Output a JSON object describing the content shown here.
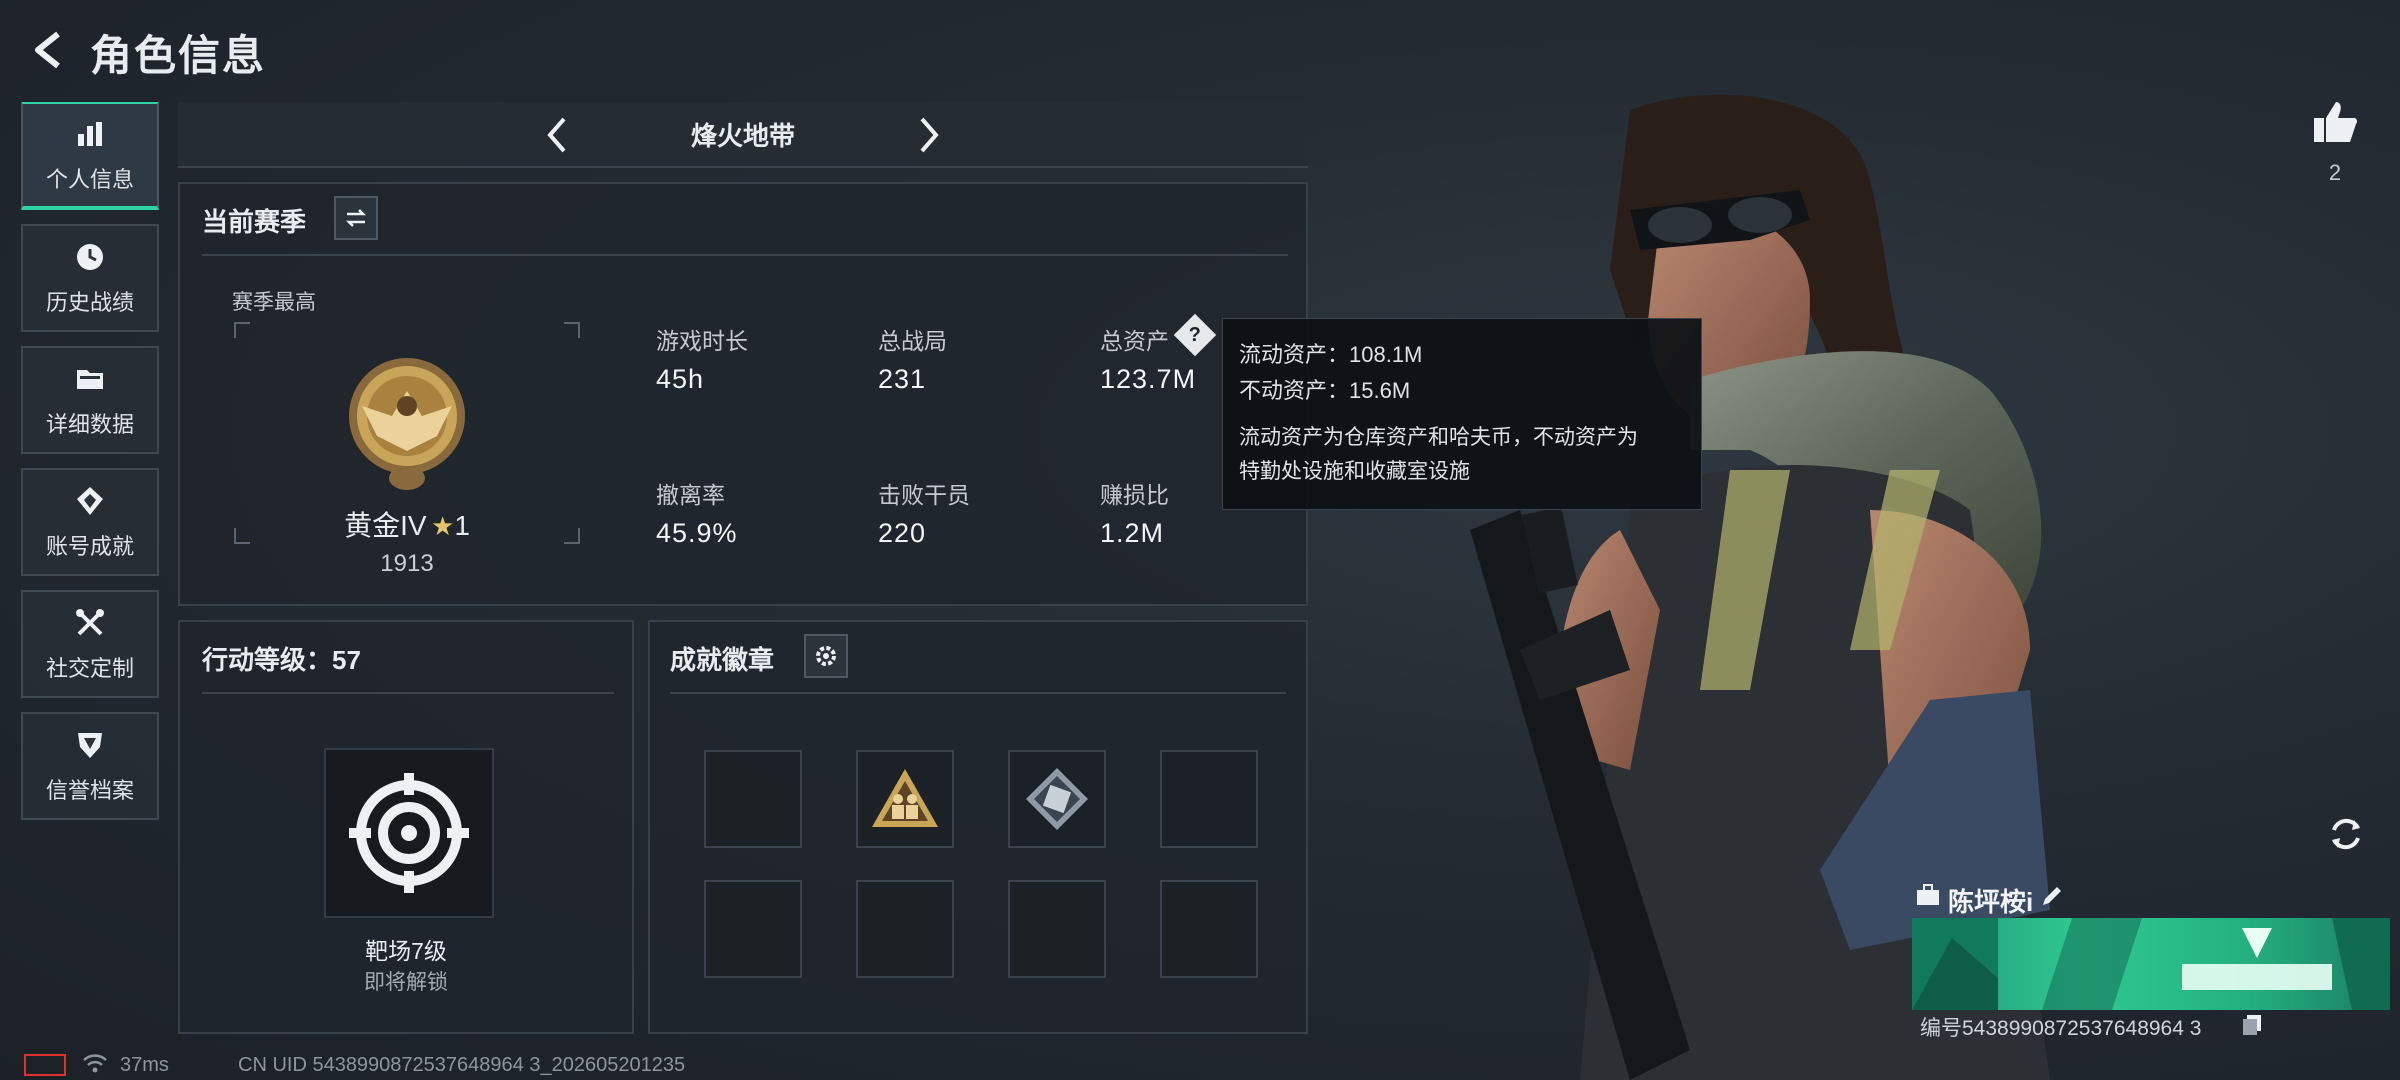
{
  "header": {
    "title": "角色信息"
  },
  "sidebar": {
    "items": [
      {
        "label": "个人信息",
        "icon": "bar-chart-icon",
        "active": true
      },
      {
        "label": "历史战绩",
        "icon": "clock-icon"
      },
      {
        "label": "详细数据",
        "icon": "folder-icon"
      },
      {
        "label": "账号成就",
        "icon": "achievement-icon"
      },
      {
        "label": "社交定制",
        "icon": "tools-icon"
      },
      {
        "label": "信誉档案",
        "icon": "shield-icon"
      }
    ]
  },
  "mode": {
    "title": "烽火地带"
  },
  "season": {
    "header": "当前赛季",
    "best_label": "赛季最高",
    "rank_name": "黄金IV",
    "rank_stars": "1",
    "rank_score": "1913",
    "stats": [
      {
        "label": "游戏时长",
        "value": "45h"
      },
      {
        "label": "总战局",
        "value": "231"
      },
      {
        "label": "总资产",
        "value": "123.7M"
      },
      {
        "label": "撤离率",
        "value": "45.9%"
      },
      {
        "label": "击败干员",
        "value": "220"
      },
      {
        "label": "赚损比",
        "value": "1.2M"
      }
    ]
  },
  "tooltip": {
    "line1": "流动资产：108.1M",
    "line2": "不动资产：15.6M",
    "desc1": "流动资产为仓库资产和哈夫币，不动资产为",
    "desc2": "特勤处设施和收藏室设施"
  },
  "level": {
    "header": "行动等级：57",
    "item_name": "靶场7级",
    "item_status": "即将解锁"
  },
  "badges": {
    "header": "成就徽章"
  },
  "right": {
    "likes": "2",
    "card_name": "陈坪桉i",
    "card_id": "编号5438990872537648964 3"
  },
  "status": {
    "ping": "37ms",
    "uid": "CN UID 5438990872537648964 3_202605201235"
  },
  "colors": {
    "accent": "#2fd3a3",
    "gold": "#c9a55a"
  }
}
